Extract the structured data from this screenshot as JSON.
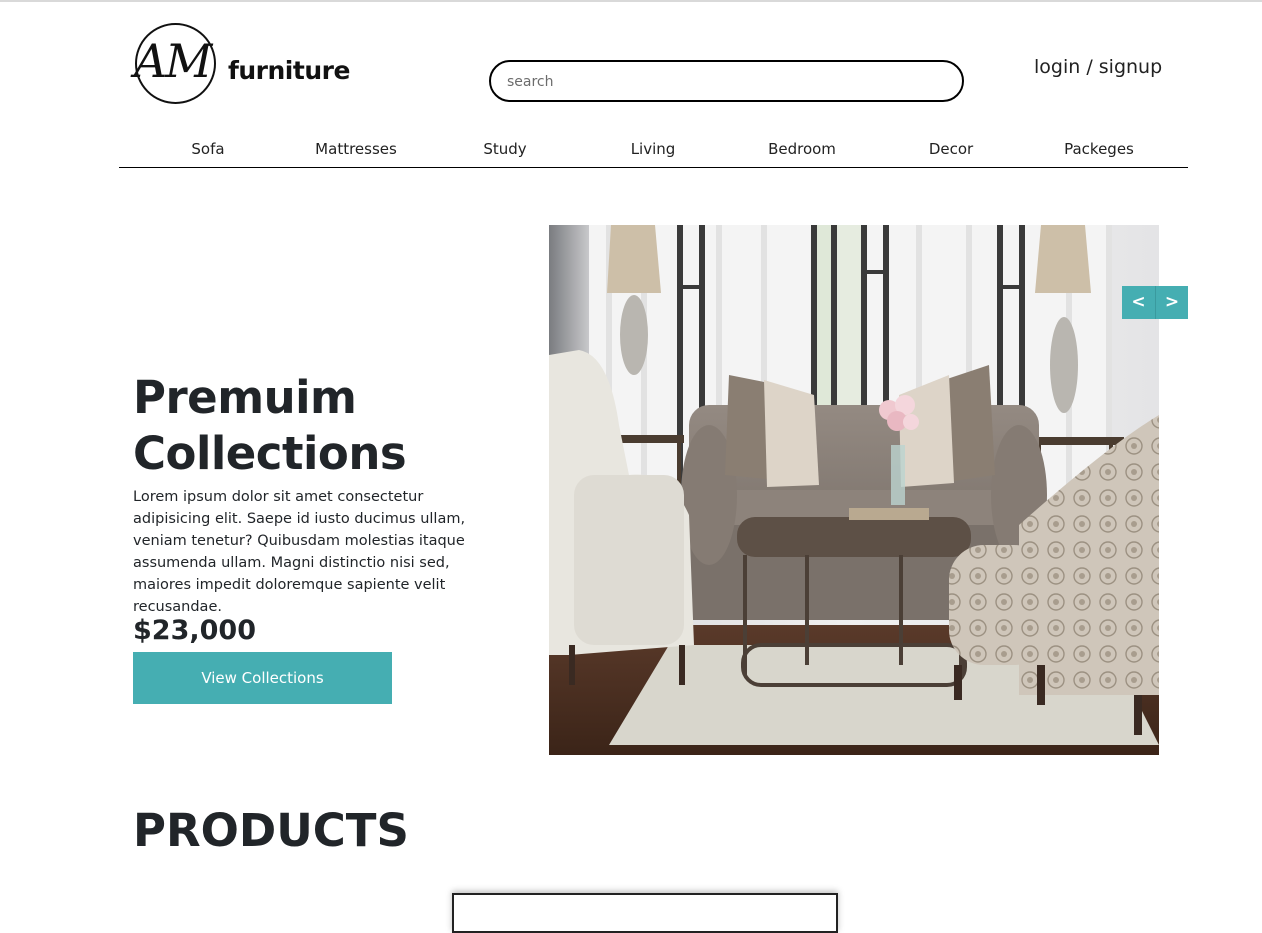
{
  "brand": {
    "logo_script": "AM",
    "logo_word": "furniture"
  },
  "search": {
    "placeholder": "search",
    "value": ""
  },
  "account": {
    "login_label": "login / signup"
  },
  "nav": {
    "items": [
      "Sofa",
      "Mattresses",
      "Study",
      "Living",
      "Bedroom",
      "Decor",
      "Packeges"
    ]
  },
  "hero": {
    "title": "Premuim Collections",
    "description": "Lorem ipsum dolor sit amet consectetur adipisicing elit. Saepe id iusto ducimus ullam, veniam tenetur? Quibusdam molestias itaque assumenda ullam. Magni distinctio nisi sed, maiores impedit doloremque sapiente velit recusandae.",
    "price": "$23,000",
    "cta_label": "View Collections",
    "image_icon": "living-room-sofa-photo"
  },
  "carousel": {
    "prev_label": "<",
    "next_label": ">"
  },
  "products": {
    "heading": "PRODUCTS"
  },
  "colors": {
    "accent": "#45aeb2",
    "text": "#212529",
    "background": "#ffffff"
  }
}
